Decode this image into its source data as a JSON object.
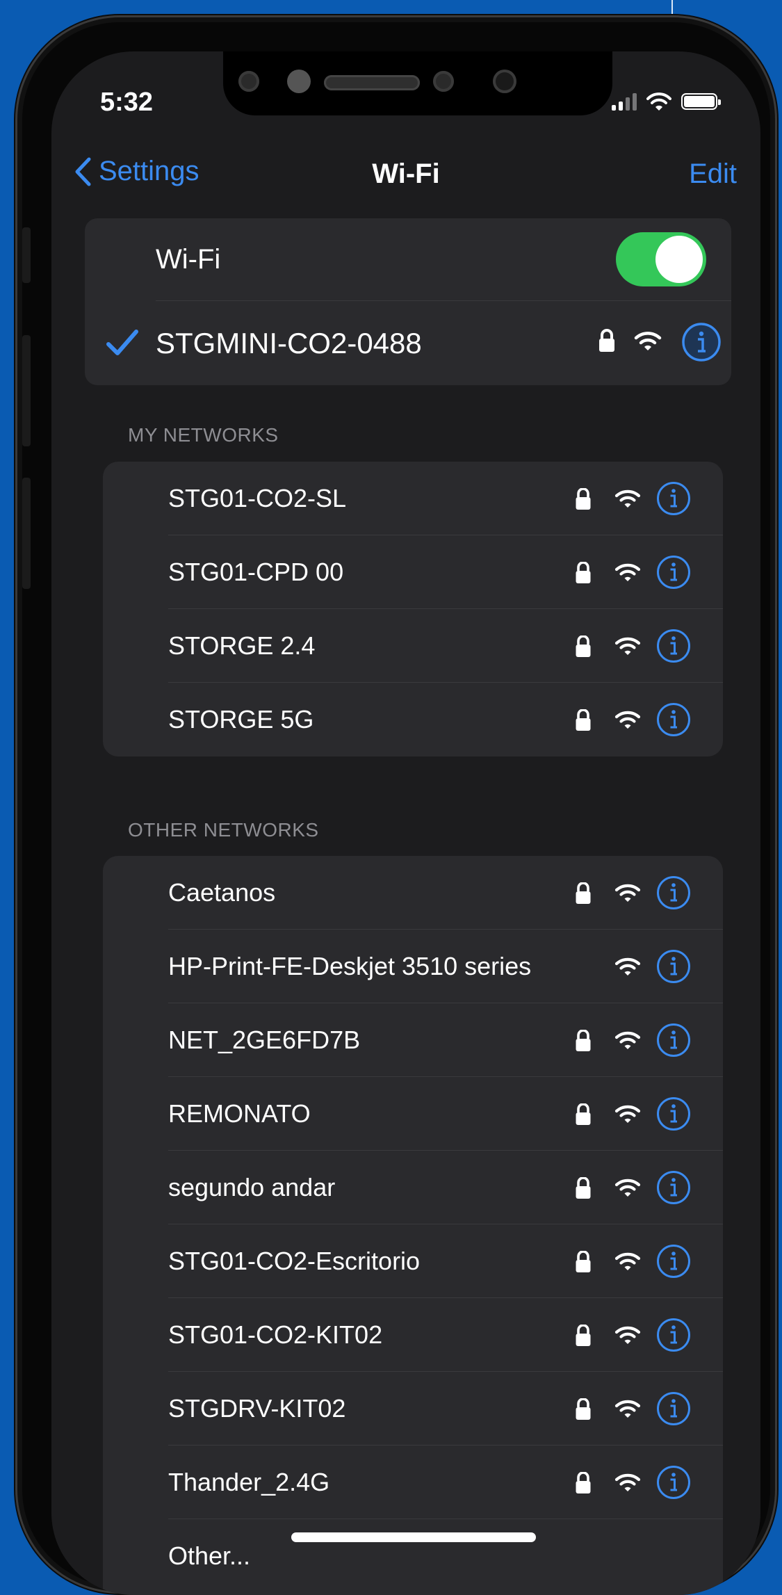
{
  "status_bar": {
    "time": "5:32"
  },
  "nav": {
    "back_label": "Settings",
    "title": "Wi-Fi",
    "edit_label": "Edit"
  },
  "wifi_toggle": {
    "label": "Wi-Fi",
    "on": true
  },
  "connected": {
    "name": "STGMINI-CO2-0488",
    "secured": true
  },
  "my_networks": {
    "header": "MY NETWORKS",
    "items": [
      {
        "name": "STG01-CO2-SL",
        "secured": true
      },
      {
        "name": "STG01-CPD 00",
        "secured": true
      },
      {
        "name": "STORGE 2.4",
        "secured": true
      },
      {
        "name": "STORGE 5G",
        "secured": true
      }
    ]
  },
  "other_networks": {
    "header": "OTHER NETWORKS",
    "items": [
      {
        "name": "Caetanos",
        "secured": true
      },
      {
        "name": "HP-Print-FE-Deskjet 3510 series",
        "secured": false
      },
      {
        "name": "NET_2GE6FD7B",
        "secured": true
      },
      {
        "name": "REMONATO",
        "secured": true
      },
      {
        "name": "segundo andar",
        "secured": true
      },
      {
        "name": "STG01-CO2-Escritorio",
        "secured": true
      },
      {
        "name": "STG01-CO2-KIT02",
        "secured": true
      },
      {
        "name": "STGDRV-KIT02",
        "secured": true
      },
      {
        "name": "Thander_2.4G",
        "secured": true
      },
      {
        "name": "Other...",
        "secured": false
      }
    ]
  },
  "colors": {
    "accent": "#3b8bf0",
    "toggle_on": "#34c759",
    "background": "#1c1c1e",
    "card": "#2a2a2d",
    "frame_backdrop": "#0a5bb2"
  }
}
